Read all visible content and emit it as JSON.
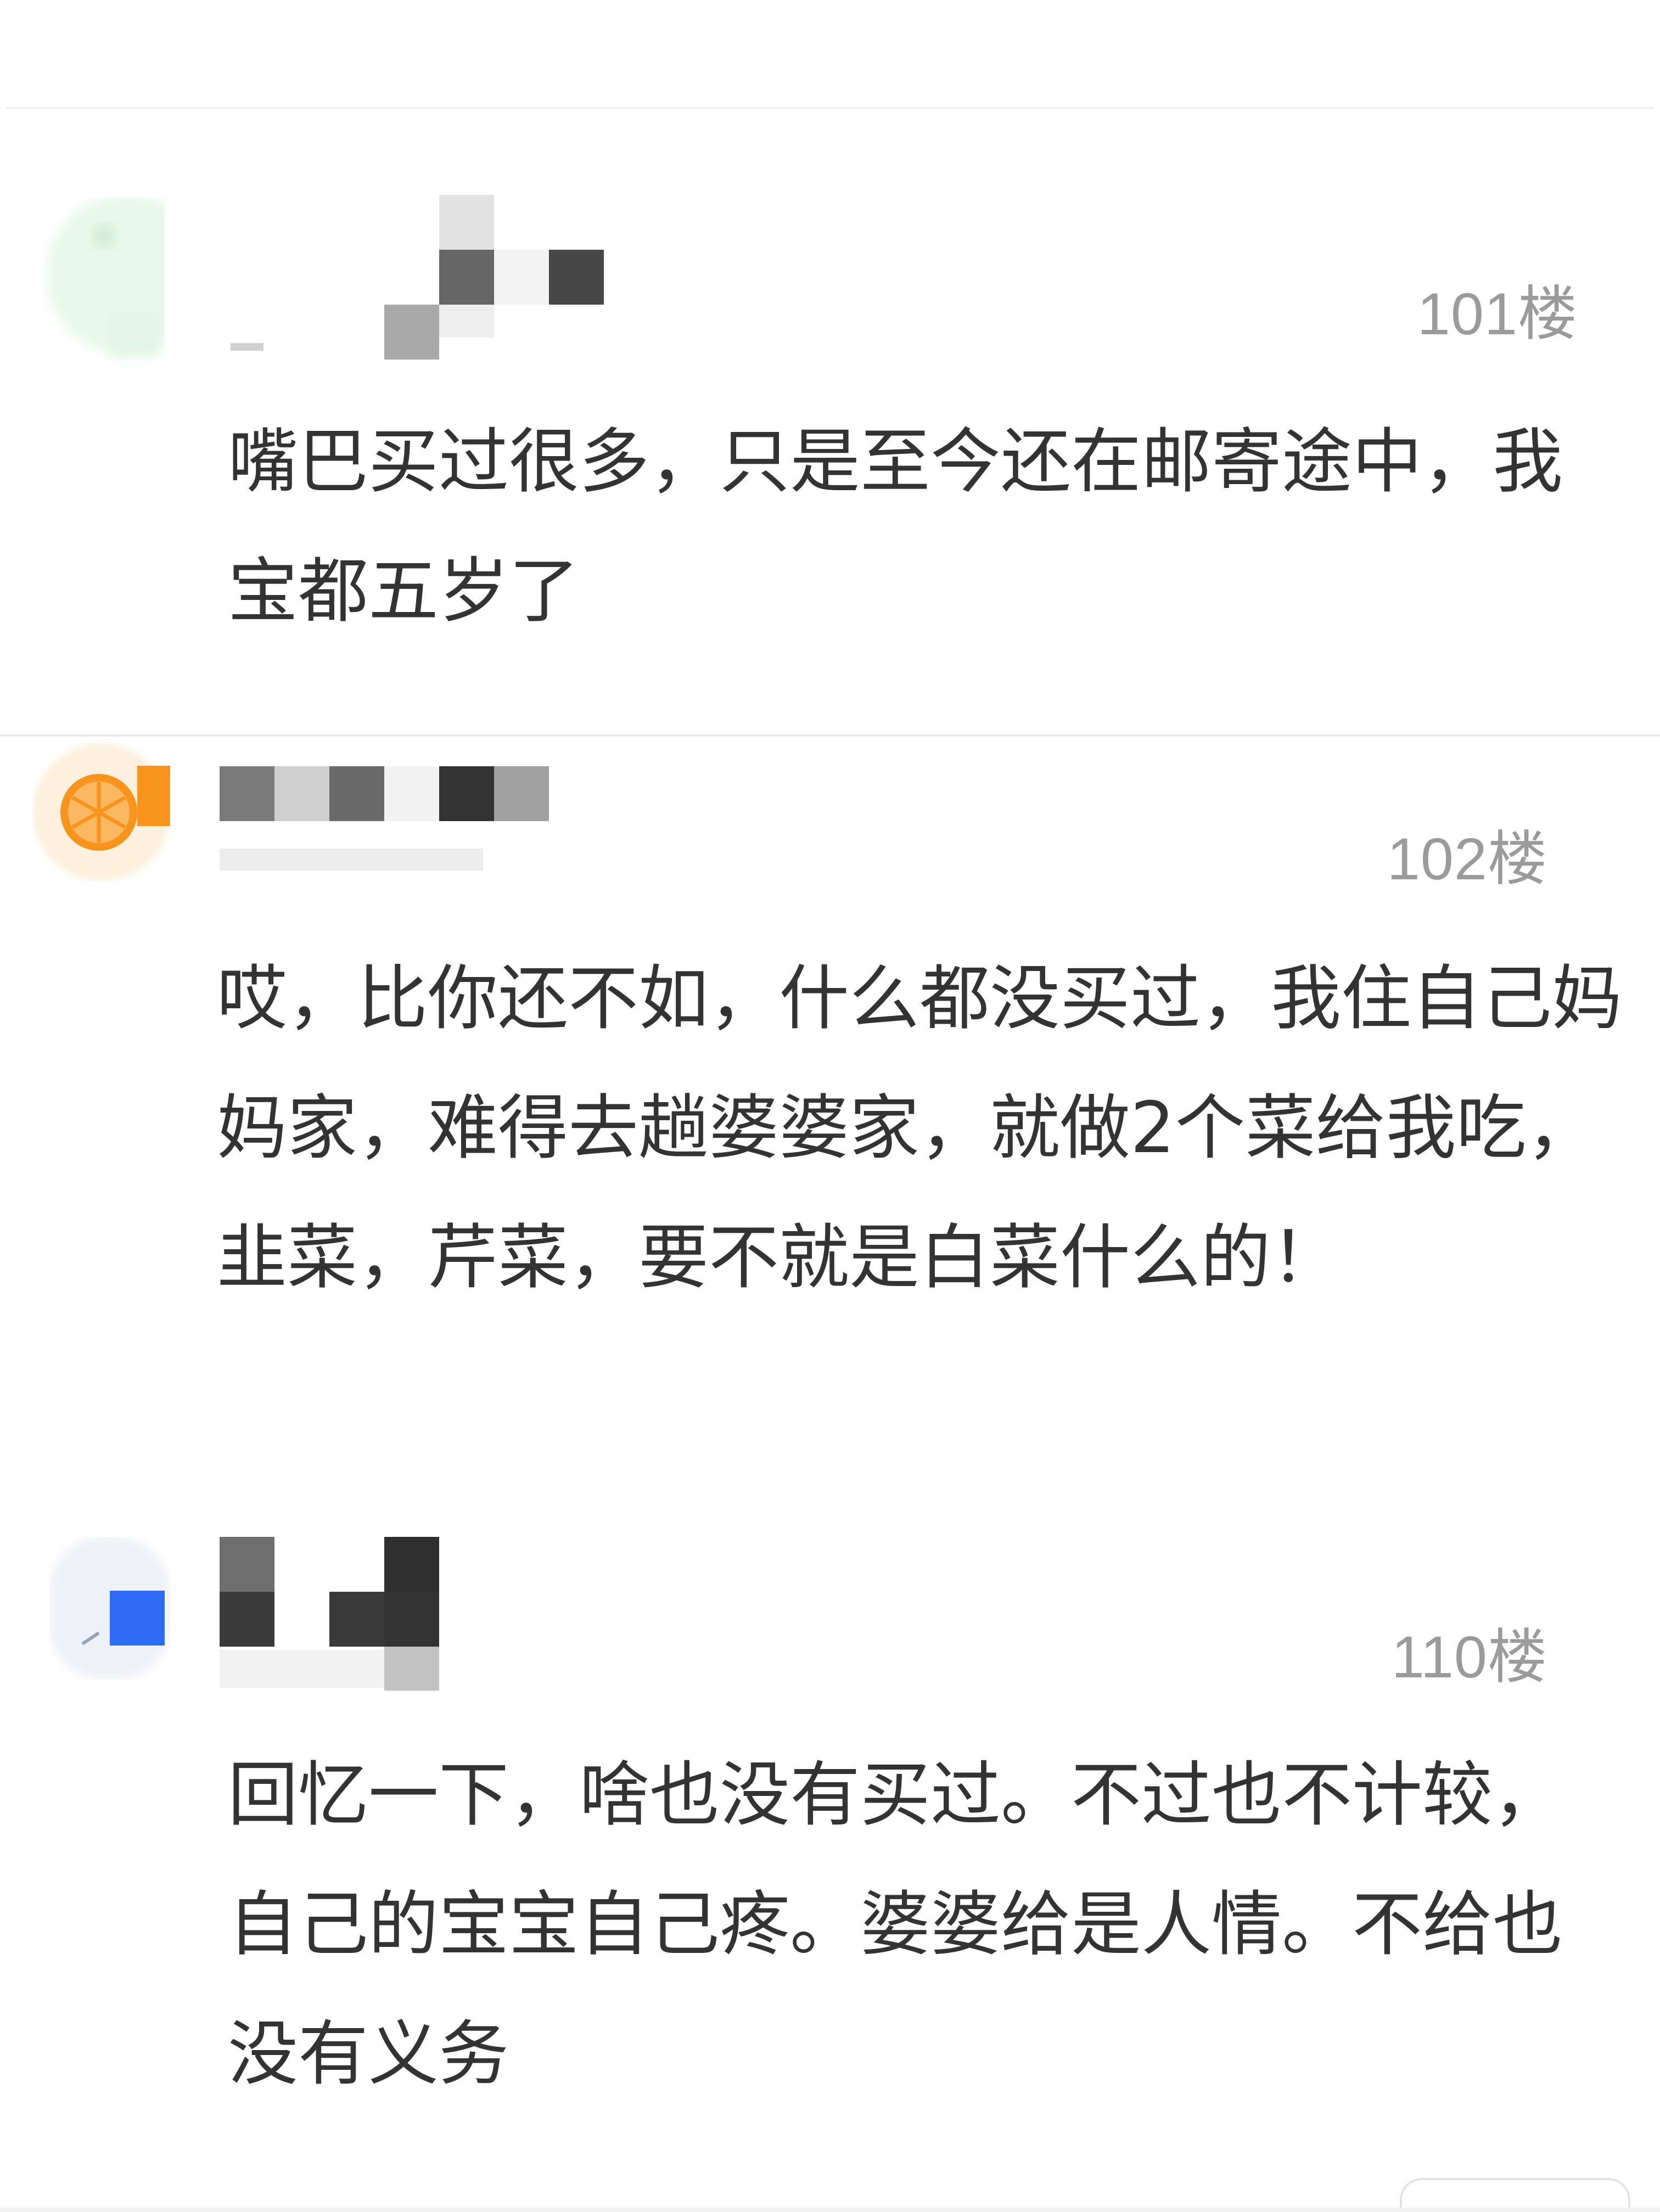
{
  "comments": [
    {
      "floor_number": "101",
      "floor_suffix": "楼",
      "text": "嘴巴买过很多，只是至今还在邮寄途中，我宝都五岁了",
      "avatar_icon": "pale-green-blurred-avatar-icon"
    },
    {
      "floor_number": "102",
      "floor_suffix": "楼",
      "text": "哎，比你还不如，什么都没买过，我住自己妈妈家，难得去趟婆婆家，就做2个菜给我吃，韭菜，芹菜，要不就是白菜什么的！",
      "avatar_icon": "orange-slice-avatar-icon"
    },
    {
      "floor_number": "110",
      "floor_suffix": "楼",
      "text": "回忆一下，啥也没有买过。不过也不计较，自己的宝宝自己疼。婆婆给是人情。不给也没有义务",
      "avatar_icon": "blue-square-avatar-icon"
    }
  ],
  "colors": {
    "text": "#333333",
    "floor_label": "#9b9b9b",
    "mosaic_dark": "#3a3a3a",
    "mosaic_mid": "#6e6e6e",
    "accent_orange": "#f7941d",
    "accent_blue": "#2f6cf6"
  }
}
